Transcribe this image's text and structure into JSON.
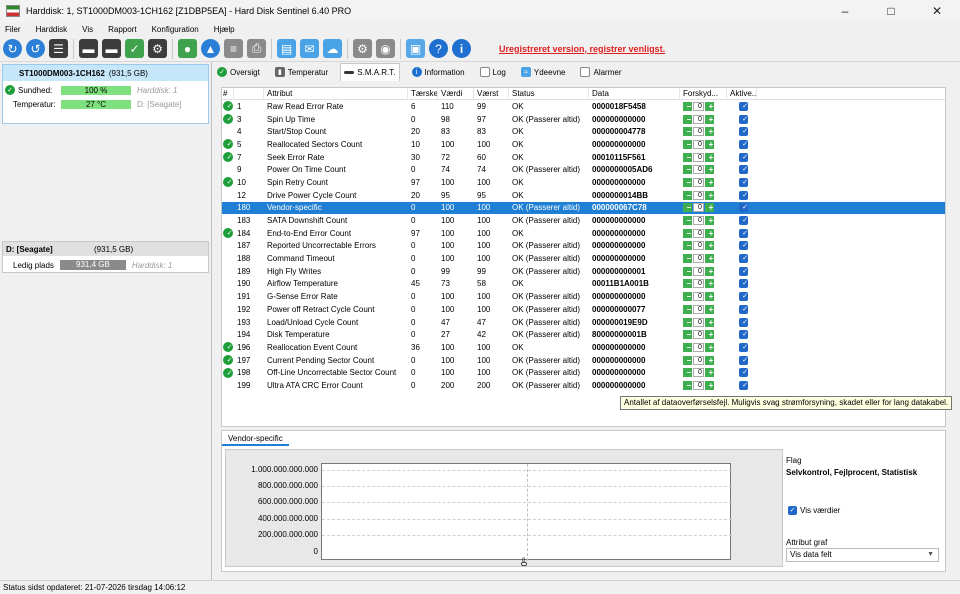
{
  "window": {
    "title": "Harddisk: 1, ST1000DM003-1CH162 [Z1DBP5EA]  -  Hard Disk Sentinel 6.40 PRO"
  },
  "menu": [
    "Filer",
    "Harddisk",
    "Vis",
    "Rapport",
    "Konfiguration",
    "Hjælp"
  ],
  "toolbar": {
    "unregistered_text": "Uregistreret version, registrer venligst."
  },
  "disk": {
    "name": "ST1000DM003-1CH162",
    "size": "(931,5 GB)",
    "health_label": "Sundhed:",
    "health_value": "100 %",
    "health_disk": "Harddisk: 1",
    "health_fraction": 1.0,
    "temp_label": "Temperatur:",
    "temp_value": "27 °C",
    "temp_drive": "D: [Seagate]"
  },
  "volume": {
    "name": "D: [Seagate]",
    "size": "(931,5 GB)",
    "free_label": "Ledig plads",
    "free_value": "931,4 GB",
    "free_disk": "Harddisk: 1"
  },
  "tabs": [
    "Oversigt",
    "Temperatur",
    "S.M.A.R.T.",
    "Information",
    "Log",
    "Ydeevne",
    "Alarmer"
  ],
  "columns": [
    "#",
    "Attribut",
    "Tærskel...",
    "Værdi",
    "Værst",
    "Status",
    "Data",
    "Forskyd...",
    "Aktive..."
  ],
  "rows": [
    {
      "ok": true,
      "id": "1",
      "name": "Raw Read Error Rate",
      "th": "6",
      "val": "110",
      "worst": "99",
      "status": "OK",
      "data": "0000018F5458"
    },
    {
      "ok": true,
      "id": "3",
      "name": "Spin Up Time",
      "th": "0",
      "val": "98",
      "worst": "97",
      "status": "OK (Passerer altid)",
      "data": "000000000000"
    },
    {
      "ok": false,
      "id": "4",
      "name": "Start/Stop Count",
      "th": "20",
      "val": "83",
      "worst": "83",
      "status": "OK",
      "data": "000000004778"
    },
    {
      "ok": true,
      "id": "5",
      "name": "Reallocated Sectors Count",
      "th": "10",
      "val": "100",
      "worst": "100",
      "status": "OK",
      "data": "000000000000"
    },
    {
      "ok": true,
      "id": "7",
      "name": "Seek Error Rate",
      "th": "30",
      "val": "72",
      "worst": "60",
      "status": "OK",
      "data": "00010115F561"
    },
    {
      "ok": false,
      "id": "9",
      "name": "Power On Time Count",
      "th": "0",
      "val": "74",
      "worst": "74",
      "status": "OK (Passerer altid)",
      "data": "0000000005AD6"
    },
    {
      "ok": true,
      "id": "10",
      "name": "Spin Retry Count",
      "th": "97",
      "val": "100",
      "worst": "100",
      "status": "OK",
      "data": "000000000000"
    },
    {
      "ok": false,
      "id": "12",
      "name": "Drive Power Cycle Count",
      "th": "20",
      "val": "95",
      "worst": "95",
      "status": "OK",
      "data": "0000000014BB"
    },
    {
      "ok": false,
      "id": "180",
      "name": "Vendor-specific",
      "th": "0",
      "val": "100",
      "worst": "100",
      "status": "OK (Passerer altid)",
      "data": "000000067C78",
      "selected": true
    },
    {
      "ok": false,
      "id": "183",
      "name": "SATA Downshift Count",
      "th": "0",
      "val": "100",
      "worst": "100",
      "status": "OK (Passerer altid)",
      "data": "000000000000"
    },
    {
      "ok": true,
      "id": "184",
      "name": "End-to-End Error Count",
      "th": "97",
      "val": "100",
      "worst": "100",
      "status": "OK",
      "data": "000000000000"
    },
    {
      "ok": false,
      "id": "187",
      "name": "Reported Uncorrectable Errors",
      "th": "0",
      "val": "100",
      "worst": "100",
      "status": "OK (Passerer altid)",
      "data": "000000000000"
    },
    {
      "ok": false,
      "id": "188",
      "name": "Command Timeout",
      "th": "0",
      "val": "100",
      "worst": "100",
      "status": "OK (Passerer altid)",
      "data": "000000000000"
    },
    {
      "ok": false,
      "id": "189",
      "name": "High Fly Writes",
      "th": "0",
      "val": "99",
      "worst": "99",
      "status": "OK (Passerer altid)",
      "data": "000000000001"
    },
    {
      "ok": false,
      "id": "190",
      "name": "Airflow Temperature",
      "th": "45",
      "val": "73",
      "worst": "58",
      "status": "OK",
      "data": "00011B1A001B"
    },
    {
      "ok": false,
      "id": "191",
      "name": "G-Sense Error Rate",
      "th": "0",
      "val": "100",
      "worst": "100",
      "status": "OK (Passerer altid)",
      "data": "000000000000"
    },
    {
      "ok": false,
      "id": "192",
      "name": "Power off Retract Cycle Count",
      "th": "0",
      "val": "100",
      "worst": "100",
      "status": "OK (Passerer altid)",
      "data": "000000000077"
    },
    {
      "ok": false,
      "id": "193",
      "name": "Load/Unload Cycle Count",
      "th": "0",
      "val": "47",
      "worst": "47",
      "status": "OK (Passerer altid)",
      "data": "000000019E9D"
    },
    {
      "ok": false,
      "id": "194",
      "name": "Disk Temperature",
      "th": "0",
      "val": "27",
      "worst": "42",
      "status": "OK (Passerer altid)",
      "data": "80000000001B"
    },
    {
      "ok": true,
      "id": "196",
      "name": "Reallocation Event Count",
      "th": "36",
      "val": "100",
      "worst": "100",
      "status": "OK",
      "data": "000000000000"
    },
    {
      "ok": true,
      "id": "197",
      "name": "Current Pending Sector Count",
      "th": "0",
      "val": "100",
      "worst": "100",
      "status": "OK (Passerer altid)",
      "data": "000000000000"
    },
    {
      "ok": true,
      "id": "198",
      "name": "Off-Line Uncorrectable Sector Count",
      "th": "0",
      "val": "100",
      "worst": "100",
      "status": "OK (Passerer altid)",
      "data": "000000000000"
    },
    {
      "ok": false,
      "id": "199",
      "name": "Ultra ATA CRC Error Count",
      "th": "0",
      "val": "200",
      "worst": "200",
      "status": "OK (Passerer altid)",
      "data": "000000000000"
    }
  ],
  "adjust_value": "0",
  "tooltip": "Antallet af dataoverførselsfejl. Muligvis svag strømforsyning, skadet eller for lang datakabel.",
  "graph": {
    "tab_label": "Vendor-specific",
    "y_labels": [
      "1.000.000.000.000",
      "800.000.000.000",
      "600.000.000.000",
      "400.000.000.000",
      "200.000.000.000",
      "0"
    ],
    "x_label": "0"
  },
  "flag": {
    "label": "Flag",
    "value": "Selvkontrol, Fejlprocent, Statistisk",
    "show_values_label": "Vis værdier",
    "attr_graph_label": "Attribut graf",
    "select_value": "Vis data felt"
  },
  "statusbar": "Status sidst opdateret: 21-07-2026 tirsdag 14:06:12"
}
